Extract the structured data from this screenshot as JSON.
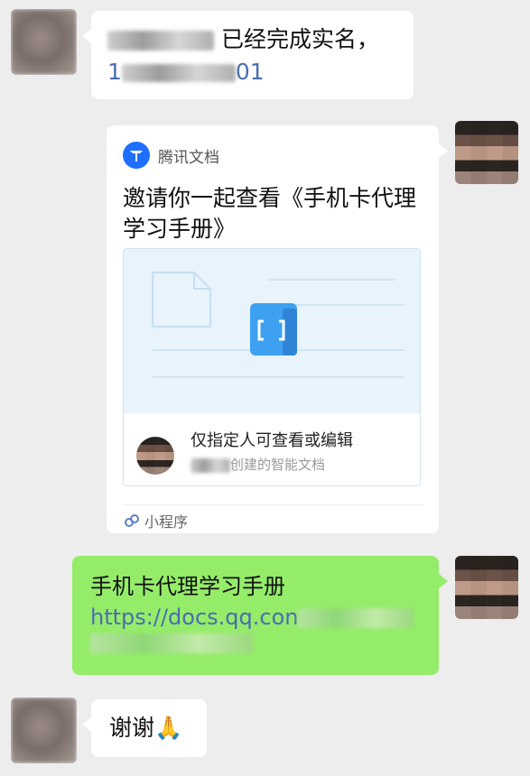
{
  "messages": [
    {
      "side": "left",
      "text_visible": "已经完成实名，",
      "link_visible_prefix": "1",
      "link_visible_suffix": "01"
    },
    {
      "side": "right",
      "type": "card",
      "app_name": "腾讯文档",
      "title": "邀请你一起查看《手机卡代理学习手册》",
      "permission": "仅指定人可查看或编辑",
      "creator_suffix": "创建的智能文档",
      "footer": "小程序"
    },
    {
      "side": "right",
      "type": "green",
      "title": "手机卡代理学习手册",
      "link_visible": "https://docs.qq.con"
    },
    {
      "side": "left",
      "text": "谢谢🙏"
    }
  ],
  "colors": {
    "background": "#ededed",
    "bubble_white": "#ffffff",
    "bubble_green": "#95ec69",
    "link": "#4a6cb2",
    "doc_brand": "#1e6fff"
  },
  "icons": {
    "doc_logo": "tencent-docs-logo",
    "mini_program": "mini-program-icon",
    "doc_preview": "document-icon"
  }
}
